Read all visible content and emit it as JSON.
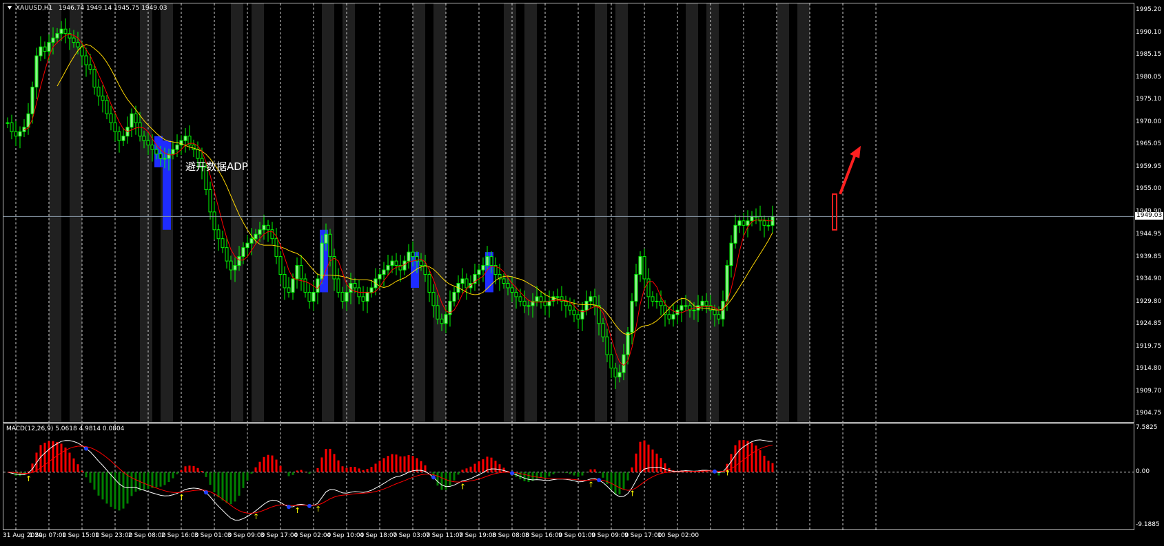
{
  "symbol_header": {
    "symbol": "XAUUSD,H1",
    "ohlc": "1946.74 1949.14 1945.75 1949.03"
  },
  "annotation": "避开数据ADP",
  "current_price_label": "1949.03",
  "colors": {
    "background": "#000000",
    "session_band": "#202020",
    "bull_candle": "#90ee90",
    "bear_candle": "#00ff00",
    "ma_fast": "#ff0000",
    "ma_slow": "#ffd700",
    "highlight_box": "#1e2cff",
    "arrow": "#ff2020",
    "macd_hist_pos": "#ff0000",
    "macd_hist_neg": "#008000",
    "macd_line": "#ffffff",
    "signal_line": "#ff0000",
    "buy_arrow": "#ffff00",
    "sell_dot": "#2040ff"
  },
  "price_axis": [
    "1995.20",
    "1990.10",
    "1985.15",
    "1980.05",
    "1975.10",
    "1970.00",
    "1965.05",
    "1959.95",
    "1955.00",
    "1949.90",
    "1944.95",
    "1939.85",
    "1934.90",
    "1929.80",
    "1924.85",
    "1919.75",
    "1914.80",
    "1909.70",
    "1904.75"
  ],
  "macd_axis": [
    "7.5825",
    "0.00",
    "-9.1885"
  ],
  "macd_header": "MACD(12,26,9) 5.0618 4.9814 0.0804",
  "time_axis": [
    "31 Aug 2020",
    "1 Sep 07:00",
    "1 Sep 15:00",
    "1 Sep 23:00",
    "2 Sep 08:00",
    "2 Sep 16:00",
    "3 Sep 01:00",
    "3 Sep 09:00",
    "3 Sep 17:00",
    "4 Sep 02:00",
    "4 Sep 10:00",
    "4 Sep 18:00",
    "7 Sep 03:00",
    "7 Sep 11:00",
    "7 Sep 19:00",
    "8 Sep 08:00",
    "8 Sep 16:00",
    "9 Sep 01:00",
    "9 Sep 09:00",
    "9 Sep 17:00",
    "10 Sep 02:00"
  ],
  "chart_data": {
    "type": "candlestick",
    "title": "XAUUSD,H1",
    "ylim": [
      1904.75,
      1995.2
    ],
    "x_label_every": 8,
    "close": [
      1970,
      1968,
      1967,
      1968,
      1969,
      1972,
      1978,
      1985,
      1987,
      1986,
      1988,
      1989,
      1990,
      1991,
      1990,
      1989,
      1988,
      1987,
      1985,
      1983,
      1982,
      1978,
      1976,
      1975,
      1972,
      1970,
      1968,
      1966,
      1967,
      1969,
      1972,
      1970,
      1967,
      1966,
      1965,
      1964,
      1963,
      1962,
      1962,
      1963,
      1964,
      1965,
      1966,
      1967,
      1965,
      1964,
      1962,
      1960,
      1955,
      1950,
      1946,
      1944,
      1942,
      1939,
      1937,
      1938,
      1940,
      1942,
      1943,
      1944,
      1945,
      1946,
      1947,
      1946,
      1944,
      1940,
      1936,
      1933,
      1932,
      1935,
      1938,
      1935,
      1932,
      1930,
      1932,
      1935,
      1943,
      1945,
      1940,
      1935,
      1932,
      1930,
      1932,
      1934,
      1933,
      1931,
      1930,
      1932,
      1933,
      1935,
      1936,
      1937,
      1938,
      1939,
      1938,
      1937,
      1939,
      1941,
      1940,
      1939,
      1938,
      1936,
      1932,
      1929,
      1926,
      1925,
      1927,
      1930,
      1932,
      1934,
      1935,
      1933,
      1934,
      1936,
      1937,
      1938,
      1940,
      1938,
      1936,
      1935,
      1934,
      1933,
      1932,
      1931,
      1930,
      1929,
      1929,
      1930,
      1931,
      1930,
      1929,
      1930,
      1931,
      1931,
      1930,
      1929,
      1928,
      1927,
      1926,
      1928,
      1930,
      1931,
      1929,
      1925,
      1922,
      1918,
      1915,
      1913,
      1914,
      1918,
      1923,
      1930,
      1936,
      1940,
      1935,
      1931,
      1930,
      1930,
      1929,
      1927,
      1926,
      1927,
      1928,
      1929,
      1929,
      1928,
      1928,
      1929,
      1930,
      1929,
      1928,
      1927,
      1926,
      1930,
      1938,
      1943,
      1947,
      1948,
      1947,
      1948,
      1949,
      1949,
      1948,
      1947,
      1947,
      1949
    ],
    "ma_fast_period": 5,
    "ma_slow_period": 13,
    "macd": {
      "header": "MACD(12,26,9) 5.0618 4.9814 0.0804",
      "ylim": [
        -9.1885,
        7.5825
      ]
    },
    "highlight_boxes": [
      {
        "start_index": 36,
        "end_index": 37,
        "top": 1967,
        "bottom": 1960
      },
      {
        "start_index": 38,
        "end_index": 39,
        "top": 1966,
        "bottom": 1946
      },
      {
        "start_index": 76,
        "end_index": 77,
        "top": 1946,
        "bottom": 1932
      },
      {
        "start_index": 98,
        "end_index": 99,
        "top": 1941,
        "bottom": 1933
      },
      {
        "start_index": 116,
        "end_index": 117,
        "top": 1941,
        "bottom": 1932
      }
    ],
    "last_box": {
      "index": 200,
      "top": 1954,
      "bottom": 1946
    },
    "sessions": [
      [
        10,
        13
      ],
      [
        15,
        18
      ],
      [
        32,
        35
      ],
      [
        37,
        40
      ],
      [
        54,
        57
      ],
      [
        59,
        62
      ],
      [
        76,
        79
      ],
      [
        81,
        84
      ],
      [
        98,
        101
      ],
      [
        103,
        106
      ],
      [
        120,
        123
      ],
      [
        125,
        128
      ],
      [
        142,
        145
      ],
      [
        147,
        150
      ],
      [
        164,
        167
      ],
      [
        169,
        172
      ],
      [
        186,
        189
      ],
      [
        191,
        194
      ]
    ]
  }
}
